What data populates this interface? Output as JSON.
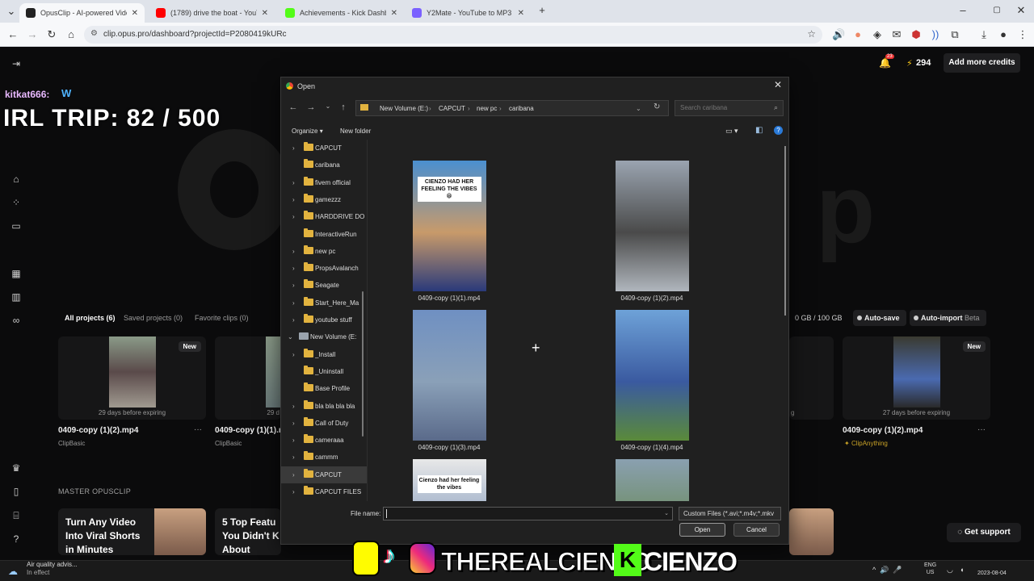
{
  "browser": {
    "tabs": [
      {
        "title": "OpusClip - AI-powered Video R",
        "favicon_color": "#222222",
        "active": true
      },
      {
        "title": "(1789) drive the boat - YouTube",
        "favicon_color": "#ff0000",
        "active": false
      },
      {
        "title": "Achievements - Kick Dashboard",
        "favicon_color": "#53fc18",
        "active": false
      },
      {
        "title": "Y2Mate - YouTube to MP3 Con",
        "favicon_color": "#7b61ff",
        "active": false
      }
    ],
    "url": "clip.opus.pro/dashboard?projectId=P2080419kURc"
  },
  "app": {
    "credits": "294",
    "notif_count": "23",
    "add_credits": "Add more credits",
    "project_tabs": [
      "All projects (6)",
      "Saved projects (0)",
      "Favorite clips (0)"
    ],
    "storage": "0 GB / 100 GB",
    "auto_save": "Auto-save",
    "auto_import": "Auto-import",
    "beta": "Beta",
    "cards": [
      {
        "name": "0409-copy (1)(2).mp4",
        "sub": "ClipBasic",
        "expiry": "29 days before expiring",
        "badge": "New"
      },
      {
        "name": "0409-copy (1)(1).m",
        "sub": "ClipBasic",
        "expiry": "29 d",
        "badge": ""
      },
      {
        "name": "0409-copy (1)(2).mp4",
        "sub": "ClipAnything",
        "expiry": "27 days before expiring",
        "badge": "New"
      }
    ],
    "master_title": "MASTER OPUSCLIP",
    "promos": [
      {
        "text": "Turn Any Video\nInto Viral Shorts\nin Minutes"
      },
      {
        "text": "5 Top Featu\nYou Didn't K\nAbout"
      }
    ],
    "support": "Get support"
  },
  "overlay": {
    "irl": "IRL TRIP:  82 / 500",
    "chat_user": "kitkat666:",
    "social_handle": "THEREALCIENZO",
    "kick_handle": "CIENZO"
  },
  "dialog": {
    "title": "Open",
    "path": [
      "New Volume (E:)",
      "CAPCUT",
      "new pc",
      "caribana"
    ],
    "search_placeholder": "Search caribana",
    "organize": "Organize",
    "new_folder": "New folder",
    "nav_items": [
      {
        "label": "CAPCUT",
        "chev": true,
        "indent": 1,
        "sel": false
      },
      {
        "label": "caribana",
        "chev": false,
        "indent": 1,
        "sel": false
      },
      {
        "label": "fivem official",
        "chev": true,
        "indent": 1,
        "sel": false
      },
      {
        "label": "gamezzz",
        "chev": true,
        "indent": 1,
        "sel": false
      },
      {
        "label": "HARDDRIVE DO",
        "chev": true,
        "indent": 1,
        "sel": false
      },
      {
        "label": "InteractiveRun",
        "chev": false,
        "indent": 1,
        "sel": false
      },
      {
        "label": "new pc",
        "chev": true,
        "indent": 1,
        "sel": false
      },
      {
        "label": "PropsAvalanch",
        "chev": true,
        "indent": 1,
        "sel": false
      },
      {
        "label": "Seagate",
        "chev": true,
        "indent": 1,
        "sel": false
      },
      {
        "label": "Start_Here_Ma",
        "chev": true,
        "indent": 1,
        "sel": false
      },
      {
        "label": "youtube stuff",
        "chev": true,
        "indent": 1,
        "sel": false
      },
      {
        "label": "New Volume (E:",
        "chev": true,
        "indent": 0,
        "sel": false,
        "drive": true
      },
      {
        "label": "_Install",
        "chev": true,
        "indent": 1,
        "sel": false
      },
      {
        "label": "_Uninstall",
        "chev": false,
        "indent": 1,
        "sel": false
      },
      {
        "label": "Base Profile",
        "chev": false,
        "indent": 1,
        "sel": false
      },
      {
        "label": "bla bla bla bla",
        "chev": true,
        "indent": 1,
        "sel": false
      },
      {
        "label": "Call of Duty",
        "chev": true,
        "indent": 1,
        "sel": false
      },
      {
        "label": "cameraaa",
        "chev": true,
        "indent": 1,
        "sel": false
      },
      {
        "label": "cammm",
        "chev": true,
        "indent": 1,
        "sel": false
      },
      {
        "label": "CAPCUT",
        "chev": true,
        "indent": 1,
        "sel": true
      },
      {
        "label": "CAPCUT FILES",
        "chev": true,
        "indent": 1,
        "sel": false
      }
    ],
    "files": [
      {
        "name": "0409-copy (1)(1).mp4",
        "caption": "CIENZO HAD HER FEELING THE VIBES😁",
        "colors": [
          "#4a8fd0",
          "#c89a6a",
          "#2a3a7a"
        ]
      },
      {
        "name": "0409-copy (1)(2).mp4",
        "caption": "",
        "colors": [
          "#9aa4b0",
          "#4a4a4a",
          "#b0b6bd"
        ]
      },
      {
        "name": "0409-copy (1)(3).mp4",
        "caption": "",
        "colors": [
          "#6f90c2",
          "#8aa0b8",
          "#5a6a8a"
        ]
      },
      {
        "name": "0409-copy (1)(4).mp4",
        "caption": "",
        "colors": [
          "#6ea2d8",
          "#3a5aa0",
          "#5a8a3a"
        ]
      },
      {
        "name": "",
        "caption": "Cienzo had her feeling the vibes",
        "colors": [
          "#e8e8e8",
          "#8aa0c0",
          "#c8b8a0"
        ]
      },
      {
        "name": "",
        "caption": "",
        "colors": [
          "#8aa0b0",
          "#6a8a5a",
          "#9ab0c0"
        ]
      }
    ],
    "file_name_label": "File name:",
    "file_name_value": "",
    "filter": "Custom Files (*.avi;*.m4v;*.mkv",
    "open_btn": "Open",
    "cancel_btn": "Cancel"
  },
  "taskbar": {
    "weather_title": "Air quality advis...",
    "weather_sub": "In effect",
    "lang1": "ENG",
    "lang2": "US",
    "date": "2023-08-04"
  }
}
